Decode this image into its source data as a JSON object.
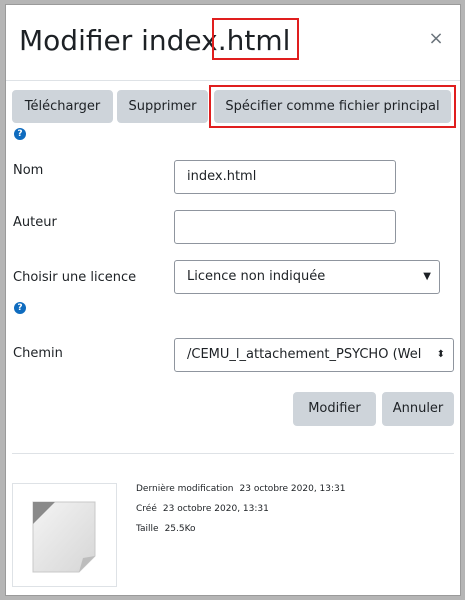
{
  "dialog": {
    "title_main": "Modifier index",
    "title_ext": ".html",
    "close_glyph": "×"
  },
  "toolbar": {
    "download_label": "Télécharger",
    "delete_label": "Supprimer",
    "set_main_label": "Spécifier comme fichier principal"
  },
  "help_glyph": "?",
  "form": {
    "name_label": "Nom",
    "name_value": "index.html",
    "author_label": "Auteur",
    "author_value": "",
    "license_label": "Choisir une licence",
    "license_value": "Licence non indiquée",
    "path_label": "Chemin",
    "path_value": "/CEMU_l_attachement_PSYCHO (Wel"
  },
  "actions": {
    "update_label": "Modifier",
    "cancel_label": "Annuler"
  },
  "fileinfo": {
    "modified_label": "Dernière modification",
    "modified_value": "23 octobre 2020, 13:31",
    "created_label": "Créé",
    "created_value": "23 octobre 2020, 13:31",
    "size_label": "Taille",
    "size_value": "25.5Ko"
  },
  "colors": {
    "highlight": "#e01e1e",
    "button_bg": "#ced4da",
    "help_icon": "#0f6cbf"
  }
}
